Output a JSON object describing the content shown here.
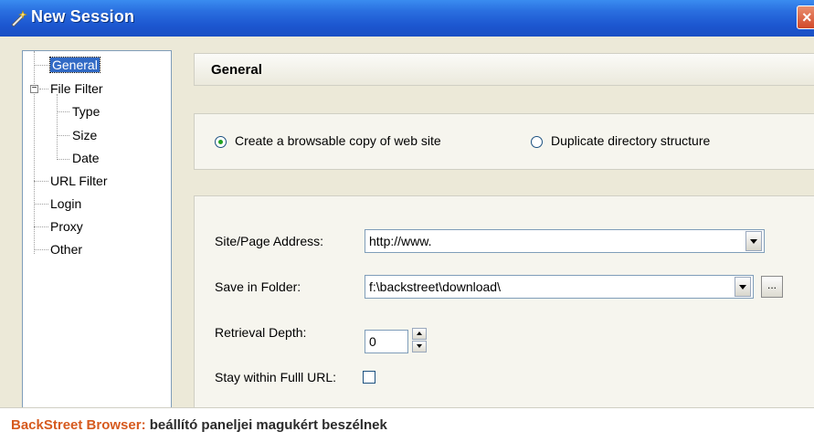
{
  "window": {
    "title": "New Session",
    "close_glyph": "×"
  },
  "tree": {
    "items": [
      {
        "label": "General",
        "selected": true
      },
      {
        "label": "File Filter",
        "expanded": true
      },
      {
        "label": "Type"
      },
      {
        "label": "Size"
      },
      {
        "label": "Date"
      },
      {
        "label": "URL Filter"
      },
      {
        "label": "Login"
      },
      {
        "label": "Proxy"
      },
      {
        "label": "Other"
      }
    ],
    "expander_glyph": "−"
  },
  "header": {
    "title": "General"
  },
  "options": {
    "browsable_copy_label": "Create a browsable copy of web site",
    "duplicate_structure_label": "Duplicate directory structure",
    "selected": "browsable_copy"
  },
  "form": {
    "site_address": {
      "label": "Site/Page Address:",
      "value": "http://www."
    },
    "save_folder": {
      "label": "Save in Folder:",
      "value": "f:\\backstreet\\download\\",
      "browse_label": "..."
    },
    "retrieval_depth": {
      "label": "Retrieval Depth:",
      "value": "0"
    },
    "stay_within": {
      "label": "Stay within Fulll URL:",
      "checked": false
    }
  },
  "caption": {
    "brand": "BackStreet Browser:",
    "text": " beállító paneljei magukért beszélnek"
  },
  "colors": {
    "titlebar": "#1c56d0",
    "selection": "#316ac5",
    "caption_brand": "#d65a1e",
    "radio_dot": "#21a121"
  },
  "icons": {
    "title": "session-wand-icon",
    "close": "close-icon"
  }
}
